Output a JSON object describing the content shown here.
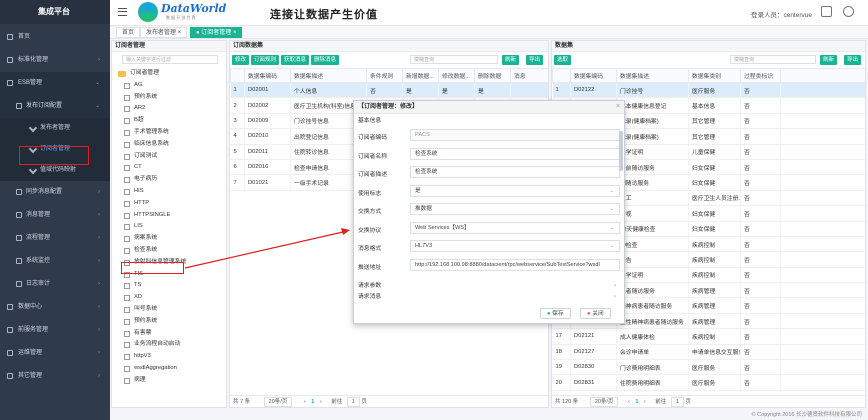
{
  "app": {
    "title": "集成平台"
  },
  "sidebar": {
    "items": [
      {
        "label": "首页"
      },
      {
        "label": "标准化管理"
      },
      {
        "label": "ESB管理"
      },
      {
        "label": "发布订阅配置"
      },
      {
        "label": "发布者管理"
      },
      {
        "label": "订阅者管理"
      },
      {
        "label": "值域代码映射"
      },
      {
        "label": "同步消息配置"
      },
      {
        "label": "消息管理"
      },
      {
        "label": "流程管理"
      },
      {
        "label": "系统监控"
      },
      {
        "label": "日志审计"
      },
      {
        "label": "数据中心"
      },
      {
        "label": "前服务管理"
      },
      {
        "label": "运维管理"
      },
      {
        "label": "其它管理"
      }
    ]
  },
  "header": {
    "logo_text": "DataWorld",
    "logo_sub": "数 据 开 创 世 界",
    "slogan": "连接让数据产生价值",
    "login_label": "登录人员：",
    "login_user": "centervue"
  },
  "tabs": {
    "home": "首页",
    "publisher": "发布者管理",
    "subscriber": "订阅者管理"
  },
  "left_panel": {
    "title": "订阅者管理",
    "search_placeholder": "输入关键字进行过滤",
    "root": "订阅者管理",
    "items": [
      "AG",
      "预约系统",
      "AR2",
      "B超",
      "手术管理系统",
      "临床信息系统",
      "订阅测试",
      "CT",
      "电子病历",
      "HIS",
      "HTTP",
      "HTTPSINGLE",
      "LIS",
      "病案系统",
      "检查系统",
      "放射科信息管理系统",
      "TIS",
      "TS",
      "XD",
      "叫号系统",
      "预约系统",
      "有害票",
      "业务流程自动启动",
      "httpV3",
      "wsdlAggregation",
      "病理"
    ]
  },
  "mid_panel": {
    "title": "订阅数据集",
    "buttons": [
      "修改",
      "订阅规则",
      "获取消息",
      "删除消息"
    ],
    "search_placeholder": "模糊查询",
    "refresh": "刷新",
    "export": "导出",
    "columns": [
      "数据集编码",
      "数据集描述",
      "条件规则",
      "新增数据...",
      "修改数据...",
      "删除数据",
      "消息"
    ],
    "rows": [
      [
        "D02001",
        "个人信息",
        "否",
        "是",
        "是",
        "是",
        ""
      ],
      [
        "D02002",
        "医疗卫生机构(科室)信息",
        "否",
        "是",
        "否",
        "否",
        ""
      ],
      [
        "D02009",
        "门诊挂号信息",
        "否",
        "是",
        "是",
        "是",
        ""
      ],
      [
        "D02010",
        "出院登记信息",
        "否",
        "是",
        "否",
        "否",
        ""
      ],
      [
        "D02011",
        "住院转诊信息",
        "否",
        "是",
        "否",
        "否",
        ""
      ],
      [
        "D02016",
        "检查申请信息",
        "否",
        "是",
        "否",
        "否",
        ""
      ],
      [
        "D01021",
        "一级手术记录",
        "否",
        "是",
        "否",
        "否",
        ""
      ]
    ],
    "footer": {
      "total": "共 7 条",
      "per_page": "20条/页",
      "prev": "前往",
      "page": "1",
      "suffix": "页"
    }
  },
  "right_panel": {
    "title": "数据集",
    "button": "选取",
    "search_placeholder": "模糊查询",
    "refresh": "刷新",
    "export": "导出",
    "columns": [
      "",
      "数据集编码",
      "数据集描述",
      "数据集类别",
      "过程类标识"
    ],
    "rows": [
      [
        "1",
        "D02122",
        "门诊挂号",
        "医疗服务",
        "否"
      ],
      [
        "2",
        "",
        "基本健康信息登记",
        "基本信息",
        "否"
      ],
      [
        "3",
        "",
        "记录(健康档案)",
        "其它管理",
        "否"
      ],
      [
        "4",
        "",
        "记录(健康档案)",
        "其它管理",
        "否"
      ],
      [
        "5",
        "",
        "卖学证明",
        "儿童保健",
        "否"
      ],
      [
        "6",
        "",
        "产前随访服务",
        "妇女保健",
        "否"
      ],
      [
        "7",
        "",
        "期随访服务",
        "妇女保健",
        "否"
      ],
      [
        "8",
        "",
        "员工",
        "医疗卫生人员注册...",
        "否"
      ],
      [
        "9",
        "",
        "访视",
        "妇女保健",
        "否"
      ],
      [
        "10",
        "",
        "42天健康检查",
        "妇女保健",
        "否"
      ],
      [
        "11",
        "",
        "种检查",
        "疾病控制",
        "否"
      ],
      [
        "12",
        "",
        "报告",
        "疾病控制",
        "否"
      ],
      [
        "13",
        "",
        "卖学证明",
        "疾病控制",
        "否"
      ],
      [
        "14",
        "",
        "患者随访服务",
        "疾病管理",
        "否"
      ],
      [
        "15",
        "",
        "精神病患者随访服务",
        "疾病管理",
        "否"
      ],
      [
        "16",
        "D02120",
        "重性精神病患者随访服务",
        "疾病管理",
        "否"
      ],
      [
        "17",
        "D02121",
        "成人健康体检",
        "疾病控制",
        "否"
      ],
      [
        "18",
        "D02127",
        "会诊申请单",
        "申请单信息交互服务",
        "否"
      ],
      [
        "19",
        "D02830",
        "门诊费用明细表",
        "医疗服务",
        "否"
      ],
      [
        "20",
        "D02831",
        "住院费用明细表",
        "医疗服务",
        "否"
      ]
    ],
    "footer": {
      "total": "共 120 条",
      "per_page": "20条/页",
      "prev": "前往",
      "page": "1",
      "suffix": "页"
    }
  },
  "modal": {
    "title": "【订阅者管理：修改】",
    "section_basic": "基本信息",
    "fields": [
      {
        "label": "订阅者编码",
        "value": "PACS"
      },
      {
        "label": "订阅者名称",
        "value": "检查系统"
      },
      {
        "label": "订阅者描述",
        "value": "检查系统"
      },
      {
        "label": "使用标志",
        "value": "是"
      },
      {
        "label": "交换方式",
        "value": "推数据"
      },
      {
        "label": "交换协议",
        "value": "Web Services【WS】"
      },
      {
        "label": "消息格式",
        "value": "HL7V3"
      },
      {
        "label": "推送地址",
        "value": "http://192.168.100.98:8880/datacient/rpc/webservice/SubTestService?wsdl"
      }
    ],
    "section_req": "请求参数",
    "section_msg": "请求消息",
    "save": "保存",
    "close": "关闭"
  },
  "copyright": "© Copyright 2016 长沙德贤软件科技有限公司"
}
